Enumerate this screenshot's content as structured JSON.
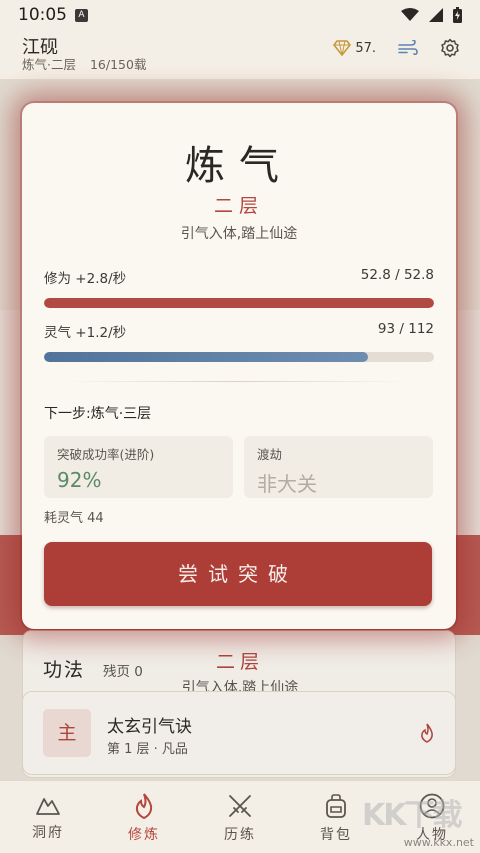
{
  "status_bar": {
    "time": "10:05",
    "notif_icon": "A"
  },
  "header": {
    "player_name": "江砚",
    "realm_short": "炼气·二层",
    "lifespan": "16/150载",
    "currency_value": "57.",
    "icons": [
      "gem-icon",
      "wind-icon",
      "gear-icon"
    ]
  },
  "breakthrough_modal": {
    "realm_name": "炼气",
    "tier": "二层",
    "description": "引气入体,踏上仙途",
    "xiuwei": {
      "label": "修为 +2.8/秒",
      "value_text": "52.8 / 52.8",
      "progress": 1.0
    },
    "lingqi": {
      "label": "灵气 +1.2/秒",
      "value_text": "93 / 112",
      "progress": 0.83
    },
    "next_step": "下一步:炼气·三层",
    "success_rate": {
      "label": "突破成功率(进阶)",
      "value": "92%"
    },
    "tribulation": {
      "label": "渡劫",
      "value": "非大关"
    },
    "cost": "耗灵气 44",
    "button_label": "尝试突破"
  },
  "background": {
    "tier": "二层",
    "description": "引气入体,踏上仙途",
    "gongfa_title": "功法",
    "gongfa_residue": "残页 0",
    "technique": {
      "badge": "主",
      "name": "太玄引气诀",
      "meta": "第 1 层 · 凡品"
    }
  },
  "bottom_nav": [
    {
      "label": "洞府",
      "icon": "mountain-icon",
      "active": false
    },
    {
      "label": "修炼",
      "icon": "flame-icon",
      "active": true
    },
    {
      "label": "历练",
      "icon": "crossed-swords-icon",
      "active": false
    },
    {
      "label": "背包",
      "icon": "backpack-icon",
      "active": false
    },
    {
      "label": "人物",
      "icon": "person-icon",
      "active": false
    }
  ],
  "watermark": "www.kkx.net",
  "colors": {
    "accent_red": "#b5463f",
    "lingqi_blue": "#52739a",
    "success_green": "#5a8a64",
    "background": "#f1ece3"
  }
}
